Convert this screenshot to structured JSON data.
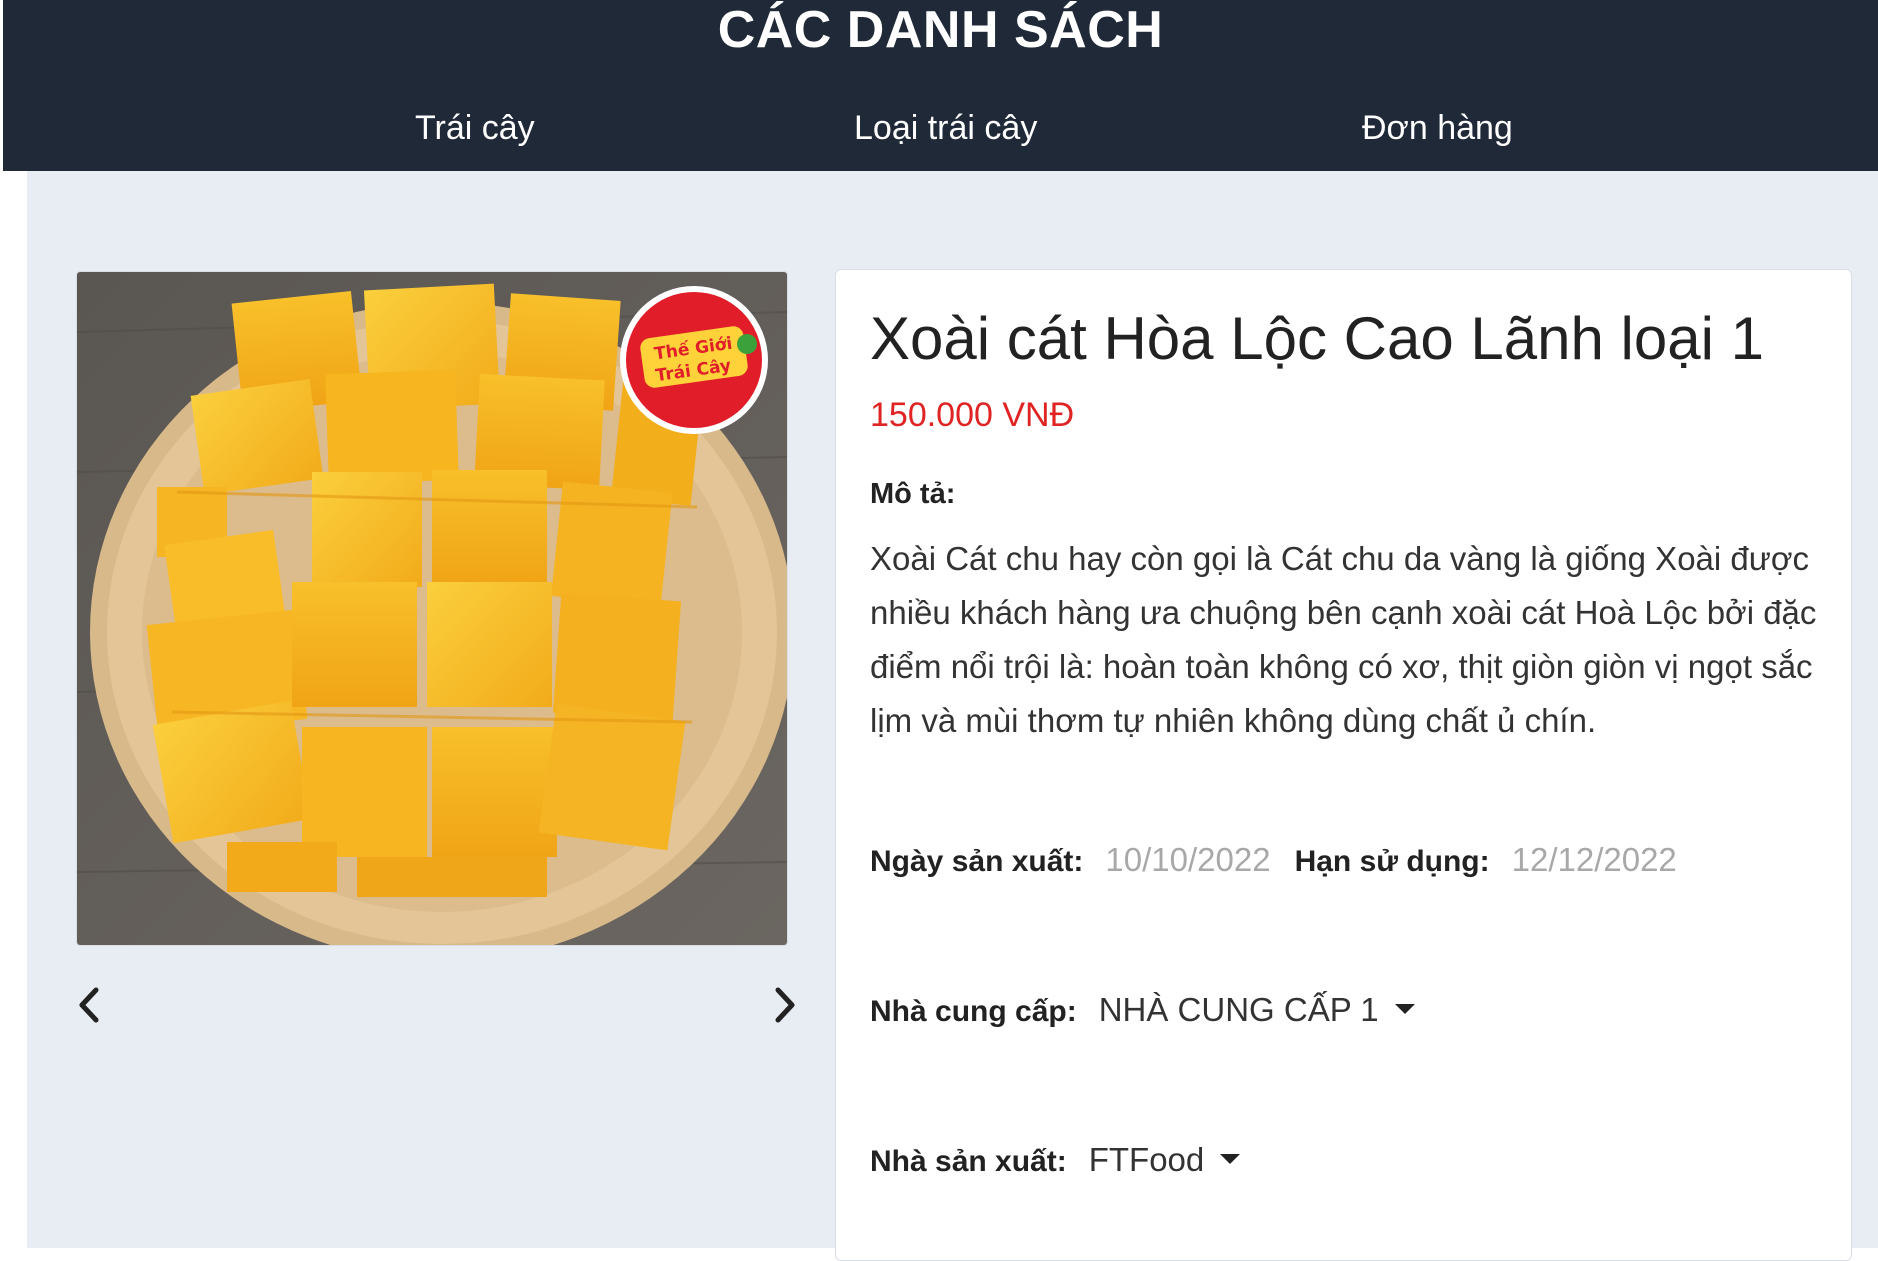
{
  "header": {
    "title": "CÁC DANH SÁCH",
    "nav": [
      {
        "label": "Trái cây"
      },
      {
        "label": "Loại trái cây"
      },
      {
        "label": "Đơn hàng"
      }
    ]
  },
  "product": {
    "name": "Xoài cát Hòa Lộc Cao Lãnh loại 1",
    "price": "150.000 VNĐ",
    "description_label": "Mô tả:",
    "description": "Xoài Cát chu hay còn gọi là Cát chu da vàng là giống Xoài được nhiều khách hàng ưa chuộng bên cạnh xoài cát Hoà Lộc bởi đặc điểm nổi trội là: hoàn toàn không có xơ, thịt giòn giòn vị ngọt sắc lịm và mùi thơm tự nhiên không dùng chất ủ chín.",
    "manufacture_date_label": "Ngày sản xuất:",
    "manufacture_date": "10/10/2022",
    "expiry_date_label": "Hạn sử dụng:",
    "expiry_date": "12/12/2022",
    "supplier_label": "Nhà cung cấp:",
    "supplier": "NHÀ CUNG CẤP 1",
    "producer_label": "Nhà sản xuất:",
    "producer": "FTFood"
  },
  "image": {
    "sticker_text": "Thế Giới Trái Cây"
  },
  "icons": {
    "prev": "chevron-left-icon",
    "next": "chevron-right-icon",
    "dropdown": "caret-down-icon"
  },
  "colors": {
    "header_bg": "#1f2937",
    "page_bg": "#e8edf3",
    "price": "#e02424",
    "date_value": "#a8a8a8"
  }
}
